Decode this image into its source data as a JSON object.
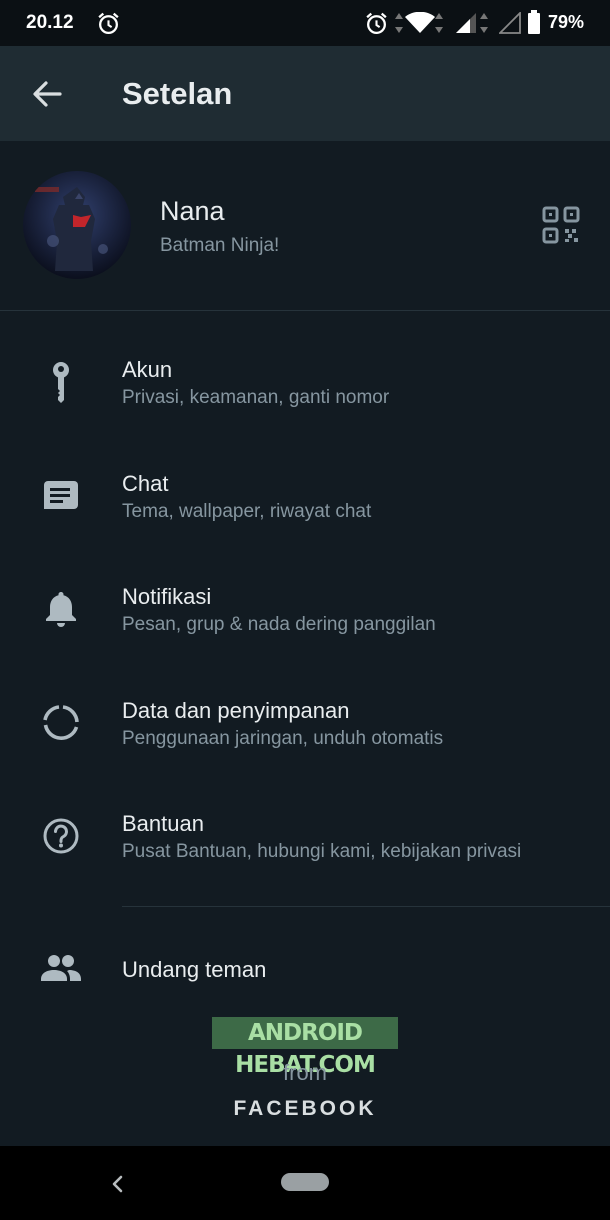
{
  "status_bar": {
    "time": "20.12",
    "battery": "79%"
  },
  "app_bar": {
    "title": "Setelan"
  },
  "profile": {
    "name": "Nana",
    "about": "Batman Ninja!"
  },
  "settings": [
    {
      "title": "Akun",
      "subtitle": "Privasi, keamanan, ganti nomor",
      "icon": "key-icon"
    },
    {
      "title": "Chat",
      "subtitle": "Tema, wallpaper, riwayat chat",
      "icon": "chat-icon"
    },
    {
      "title": "Notifikasi",
      "subtitle": "Pesan, grup & nada dering panggilan",
      "icon": "bell-icon"
    },
    {
      "title": "Data dan penyimpanan",
      "subtitle": "Penggunaan jaringan, unduh otomatis",
      "icon": "data-usage-icon"
    },
    {
      "title": "Bantuan",
      "subtitle": "Pusat Bantuan, hubungi kami, kebijakan privasi",
      "icon": "help-icon"
    }
  ],
  "invite": {
    "label": "Undang teman",
    "icon": "people-icon"
  },
  "watermark": "ANDROID HEBAT.COM",
  "footer": {
    "from": "from",
    "company": "FACEBOOK"
  },
  "colors": {
    "background": "#121b22",
    "app_bar": "#1f2c33",
    "primary_text": "#e9edef",
    "secondary_text": "#8696a0",
    "icon": "#aebac1"
  }
}
